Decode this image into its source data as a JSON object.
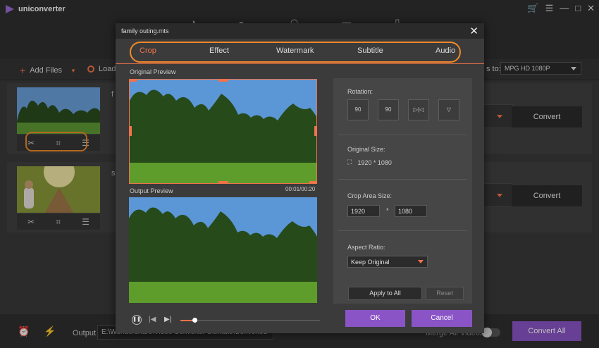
{
  "app": {
    "title": "uniconverter",
    "controls": {
      "cart": "🛒",
      "menu": "☰",
      "minimize": "—",
      "maximize": "□",
      "close": "✕"
    }
  },
  "toolbar": {
    "add_files": "Add Files",
    "load": "Load",
    "convert_to": "s to:",
    "format": "MPG HD 1080P"
  },
  "files": [
    {
      "name_stub": "f",
      "convert": "Convert"
    },
    {
      "name_stub": "s",
      "convert": "Convert"
    }
  ],
  "bottom": {
    "output_label": "Output",
    "output_path": "E:\\Wondershare\\Video Converter Ultimate\\Converted",
    "merge": "Merge All Videos",
    "convert_all": "Convert All"
  },
  "dialog": {
    "title": "family outing.mts",
    "tabs": [
      "Crop",
      "Effect",
      "Watermark",
      "Subtitle",
      "Audio"
    ],
    "active_tab": "Crop",
    "original_preview": "Original Preview",
    "output_preview": "Output Preview",
    "timecode": "00:01/00:20",
    "progress": 0.1,
    "rotation_label": "Rotation:",
    "rotation_buttons": [
      "90",
      "90",
      "▷|◁",
      "▽"
    ],
    "original_size_label": "Original Size:",
    "original_size": "1920 * 1080",
    "crop_area_label": "Crop Area Size:",
    "crop_width": "1920",
    "crop_height": "1080",
    "times": "*",
    "aspect_label": "Aspect Ratio:",
    "aspect_value": "Keep Original",
    "apply_all": "Apply to All",
    "reset": "Reset",
    "ok": "OK",
    "cancel": "Cancel"
  },
  "colors": {
    "accent": "#f0734a",
    "highlight": "#f08a2a",
    "purple": "#8a54c6"
  }
}
